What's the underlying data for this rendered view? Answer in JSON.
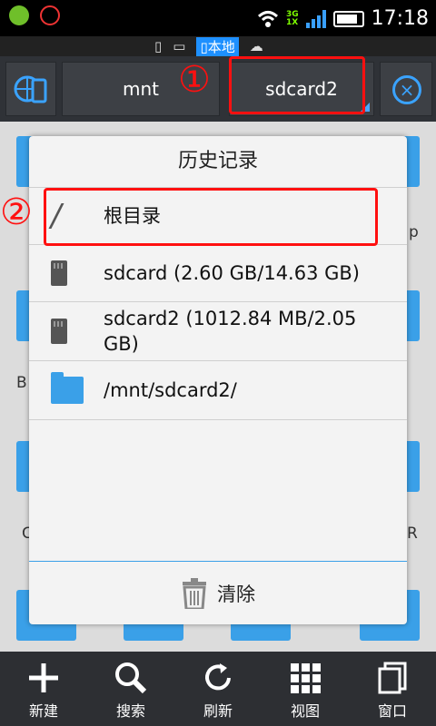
{
  "status": {
    "time": "17:18",
    "net_top": "3G",
    "net_bottom": "1X"
  },
  "locations": {
    "active_label": "本地"
  },
  "pathbar": {
    "crumb1": "mnt",
    "crumb2": "sdcard2"
  },
  "annotations": {
    "mark1": "①",
    "mark2": "②"
  },
  "background_partial": {
    "right1": "p",
    "left1": "B",
    "left2": "C",
    "right2": "R"
  },
  "dialog": {
    "title": "历史记录",
    "items": [
      {
        "icon": "slash-icon",
        "label": "根目录"
      },
      {
        "icon": "sdcard-icon",
        "label": "sdcard (2.60 GB/14.63 GB)"
      },
      {
        "icon": "sdcard-icon",
        "label": "sdcard2 (1012.84 MB/2.05 GB)"
      },
      {
        "icon": "folder-icon",
        "label": "/mnt/sdcard2/"
      }
    ],
    "clear_label": "清除"
  },
  "toolbar": {
    "new": "新建",
    "search": "搜索",
    "refresh": "刷新",
    "view": "视图",
    "window": "窗口"
  },
  "colors": {
    "accent": "#3aa0e8",
    "highlight": "#ff1010"
  }
}
